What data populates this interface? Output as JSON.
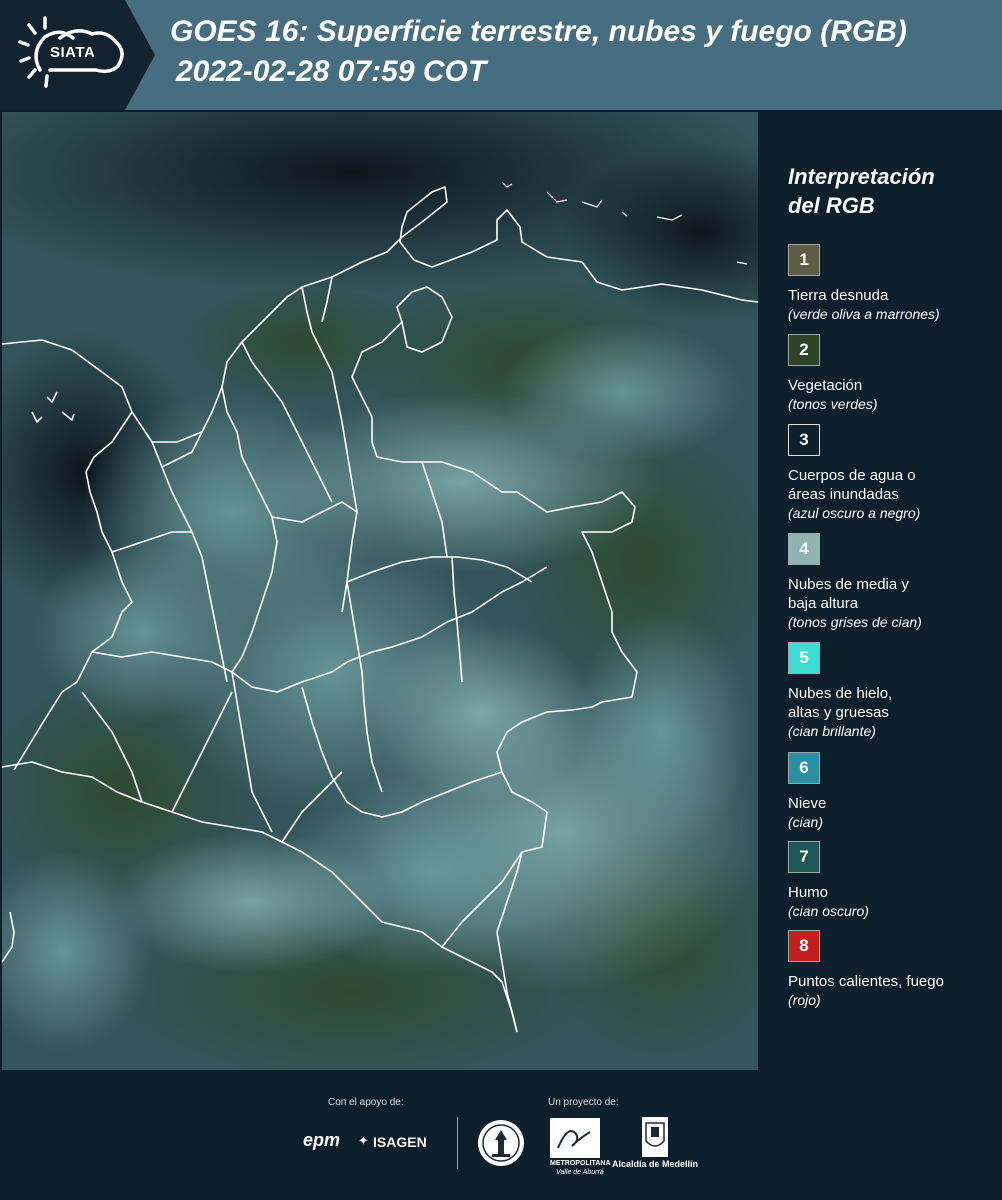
{
  "header": {
    "logo_text": "SIATA",
    "title": "GOES 16: Superficie terrestre, nubes y fuego (RGB)",
    "subtitle": "2022-02-28 07:59 COT",
    "color": "#476e80"
  },
  "legend": {
    "title_line1": "Interpretación",
    "title_line2": "del RGB",
    "items": [
      {
        "number": "1",
        "label": "Tierra desnuda",
        "note": "(verde oliva a marrones)",
        "color": "#5f5e44"
      },
      {
        "number": "2",
        "label": "Vegetación",
        "note": "(tonos verdes)",
        "color": "#2e4424"
      },
      {
        "number": "3",
        "label_line1": "Cuerpos de agua o",
        "label_line2": "áreas inundadas",
        "note": "(azul oscuro a negro)",
        "color": "#0d1f2b"
      },
      {
        "number": "4",
        "label_line1": "Nubes de media y",
        "label_line2": "baja altura",
        "note": "(tonos grises de cian)",
        "color": "#8fb3b1"
      },
      {
        "number": "5",
        "label_line1": "Nubes de hielo,",
        "label_line2": "altas y gruesas",
        "note": "(cian brillante)",
        "color": "#3fdcd6"
      },
      {
        "number": "6",
        "label": "Nieve",
        "note": "(cian)",
        "color": "#2a8ea3"
      },
      {
        "number": "7",
        "label": "Humo",
        "note": "(cian oscuro)",
        "color": "#1e5559"
      },
      {
        "number": "8",
        "label": "Puntos calientes, fuego",
        "note": "(rojo)",
        "color": "#c41e1e"
      }
    ]
  },
  "footer": {
    "support_label": "Con el apoyo de:",
    "project_label": "Un proyecto de:",
    "sponsor_epm": "epm",
    "sponsor_isagen": "ISAGEN",
    "area_caption_line1": "METROPOLITANA",
    "area_caption_line2": "Valle de Aburrá",
    "medellin_caption": "Alcaldía de Medellín"
  }
}
